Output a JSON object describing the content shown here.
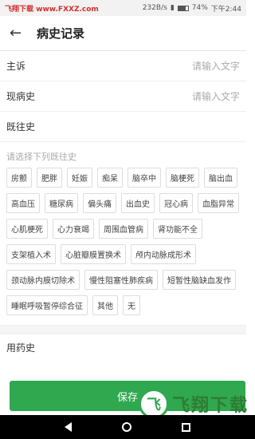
{
  "status": {
    "left": "飞翔下载 www.FXXZ.com",
    "speed": "232B/s",
    "battery": "74%",
    "time": "下午2:44"
  },
  "header": {
    "title": "病史记录"
  },
  "fields": [
    {
      "label": "主诉",
      "placeholder": "请输入文字"
    },
    {
      "label": "现病史",
      "placeholder": "请输入文字"
    }
  ],
  "past_history": {
    "label": "既往史",
    "hint": "请选择下列既往史",
    "tags": [
      "房颤",
      "肥胖",
      "妊娠",
      "痴呆",
      "脑卒中",
      "脑梗死",
      "脑出血",
      "高血压",
      "糖尿病",
      "偏头痛",
      "出血史",
      "冠心病",
      "血脂异常",
      "心肌梗死",
      "心力衰竭",
      "周围血管病",
      "肾功能不全",
      "支架植入术",
      "心脏瓣膜置换术",
      "颅内动脉成形术",
      "颈动脉内膜切除术",
      "慢性阻塞性肺疾病",
      "短暂性脑缺血发作",
      "睡眠呼吸暂停综合征",
      "其他",
      "无"
    ]
  },
  "medication": {
    "label": "用药史"
  },
  "save_button": {
    "label": "保存"
  },
  "watermark": {
    "text": "飞翔下载"
  }
}
